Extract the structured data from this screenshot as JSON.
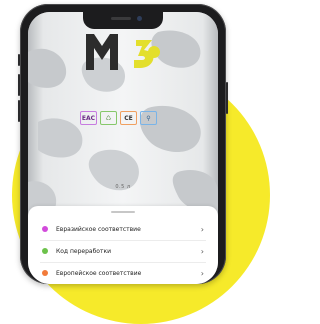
{
  "product": {
    "volume_label": "0.5 л"
  },
  "certifications": [
    "EAC",
    "♺",
    "CE",
    "⚲"
  ],
  "sheet": {
    "items": [
      {
        "label": "Евразийское соответствие",
        "color": "#d24bdb"
      },
      {
        "label": "Код переработки",
        "color": "#6cc24a"
      },
      {
        "label": "Европейское соответствие",
        "color": "#f27b3a"
      }
    ]
  },
  "colors": {
    "background_circle": "#f6ea2a",
    "phone": "#1c1c1e"
  }
}
